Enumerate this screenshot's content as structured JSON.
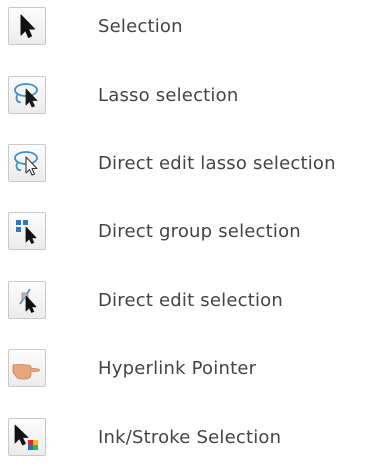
{
  "tools": [
    {
      "icon": "arrow-pointer-icon",
      "label": "Selection"
    },
    {
      "icon": "lasso-selection-icon",
      "label": "Lasso selection"
    },
    {
      "icon": "direct-edit-lasso-icon",
      "label": "Direct edit lasso selection"
    },
    {
      "icon": "direct-group-selection-icon",
      "label": "Direct group selection"
    },
    {
      "icon": "direct-edit-selection-icon",
      "label": "Direct edit selection"
    },
    {
      "icon": "hand-pointer-icon",
      "label": "Hyperlink Pointer"
    },
    {
      "icon": "ink-stroke-selection-icon",
      "label": "Ink/Stroke Selection"
    }
  ]
}
